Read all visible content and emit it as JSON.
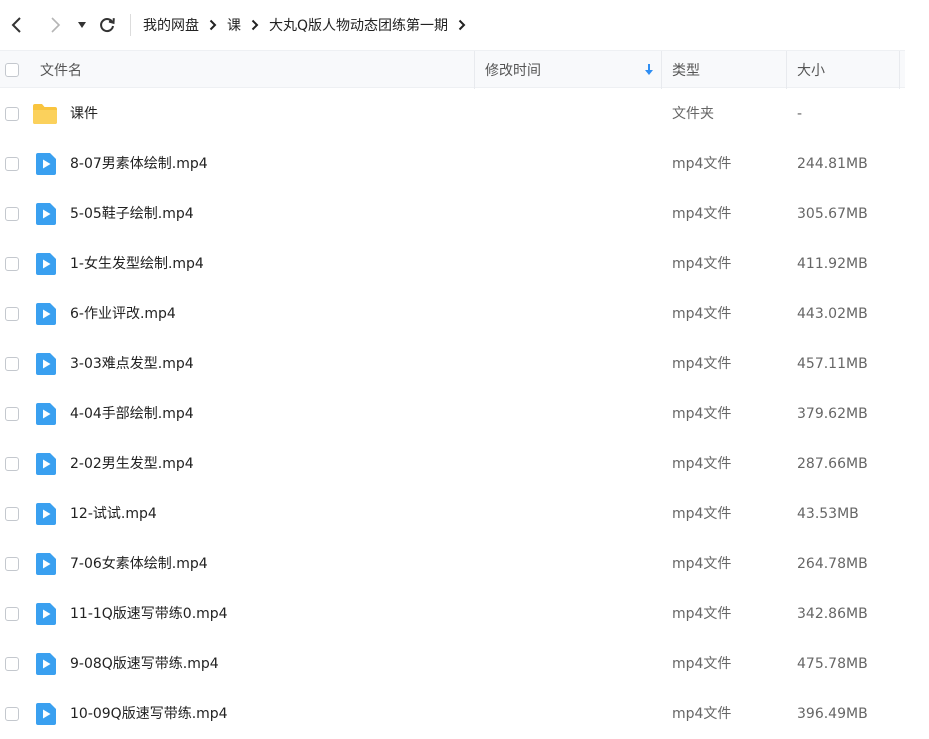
{
  "breadcrumb": {
    "items": [
      "我的网盘",
      "课",
      "大丸Q版人物动态团练第一期"
    ]
  },
  "columns": {
    "name": "文件名",
    "modified": "修改时间",
    "type": "类型",
    "size": "大小"
  },
  "colors": {
    "folder": "#f9c43e",
    "video": "#3aa0f0",
    "sort": "#2f8ef3"
  },
  "files": [
    {
      "name": "课件",
      "type": "文件夹",
      "size": "-",
      "icon": "folder-icon"
    },
    {
      "name": "8-07男素体绘制.mp4",
      "type": "mp4文件",
      "size": "244.81MB",
      "icon": "video-file-icon"
    },
    {
      "name": "5-05鞋子绘制.mp4",
      "type": "mp4文件",
      "size": "305.67MB",
      "icon": "video-file-icon"
    },
    {
      "name": "1-女生发型绘制.mp4",
      "type": "mp4文件",
      "size": "411.92MB",
      "icon": "video-file-icon"
    },
    {
      "name": "6-作业评改.mp4",
      "type": "mp4文件",
      "size": "443.02MB",
      "icon": "video-file-icon"
    },
    {
      "name": "3-03难点发型.mp4",
      "type": "mp4文件",
      "size": "457.11MB",
      "icon": "video-file-icon"
    },
    {
      "name": "4-04手部绘制.mp4",
      "type": "mp4文件",
      "size": "379.62MB",
      "icon": "video-file-icon"
    },
    {
      "name": "2-02男生发型.mp4",
      "type": "mp4文件",
      "size": "287.66MB",
      "icon": "video-file-icon"
    },
    {
      "name": "12-试试.mp4",
      "type": "mp4文件",
      "size": "43.53MB",
      "icon": "video-file-icon"
    },
    {
      "name": "7-06女素体绘制.mp4",
      "type": "mp4文件",
      "size": "264.78MB",
      "icon": "video-file-icon"
    },
    {
      "name": "11-1Q版速写带练0.mp4",
      "type": "mp4文件",
      "size": "342.86MB",
      "icon": "video-file-icon"
    },
    {
      "name": "9-08Q版速写带练.mp4",
      "type": "mp4文件",
      "size": "475.78MB",
      "icon": "video-file-icon"
    },
    {
      "name": "10-09Q版速写带练.mp4",
      "type": "mp4文件",
      "size": "396.49MB",
      "icon": "video-file-icon"
    }
  ]
}
